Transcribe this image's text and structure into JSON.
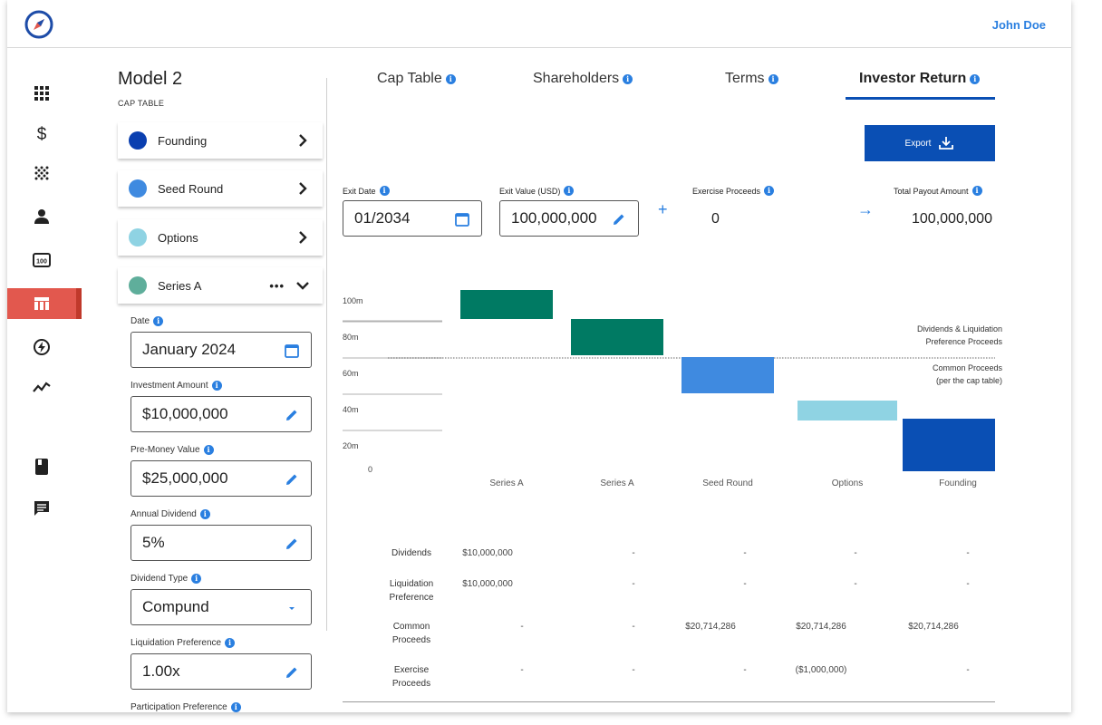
{
  "header": {
    "user_name": "John Doe"
  },
  "nav": {
    "items": [
      {
        "name": "apps-grid-icon"
      },
      {
        "name": "dollar-icon"
      },
      {
        "name": "dots-pattern-icon"
      },
      {
        "name": "person-icon"
      },
      {
        "name": "counter-icon"
      },
      {
        "name": "table-icon",
        "active": true
      },
      {
        "name": "lightning-icon"
      },
      {
        "name": "trend-icon"
      },
      {
        "name": "book-icon"
      },
      {
        "name": "chat-icon"
      }
    ]
  },
  "panel": {
    "title": "Model 2",
    "subtitle": "CAP TABLE",
    "rounds": [
      {
        "label": "Founding",
        "color": "#0a3fb0"
      },
      {
        "label": "Seed Round",
        "color": "#3f8ae0"
      },
      {
        "label": "Options",
        "color": "#8fd3e3"
      },
      {
        "label": "Series A",
        "color": "#5fae9b",
        "more": "•••"
      }
    ],
    "fields": {
      "date": {
        "label": "Date",
        "value": "January 2024"
      },
      "investment": {
        "label": "Investment Amount",
        "value": "$10,000,000"
      },
      "premoney": {
        "label": "Pre-Money Value",
        "value": "$25,000,000"
      },
      "dividend": {
        "label": "Annual Dividend",
        "value": "5%"
      },
      "dividend_type": {
        "label": "Dividend Type",
        "value": "Compund"
      },
      "liquidation": {
        "label": "Liquidation Preference",
        "value": "1.00x"
      },
      "participation": {
        "label": "Participation Preference"
      }
    }
  },
  "tabs": [
    {
      "label": "Cap Table"
    },
    {
      "label": "Shareholders"
    },
    {
      "label": "Terms"
    },
    {
      "label": "Investor Return",
      "active": true
    }
  ],
  "export": {
    "label": "Export"
  },
  "exit": {
    "exit_date_label": "Exit Date",
    "exit_date": "01/2034",
    "exit_value_label": "Exit Value (USD)",
    "exit_value": "100,000,000",
    "exercise_label": "Exercise Proceeds",
    "exercise_value": "0",
    "total_label": "Total Payout Amount",
    "total_value": "100,000,000",
    "plus": "+",
    "arrow": "→"
  },
  "chart_data": {
    "type": "bar",
    "subtype": "waterfall",
    "y_tick_labels": [
      "100m",
      "80m",
      "60m",
      "40m",
      "20m",
      "0"
    ],
    "ylim": [
      0,
      100
    ],
    "categories": [
      "Series A",
      "Series A",
      "Seed Round",
      "Options",
      "Founding"
    ],
    "bars": [
      {
        "start": 84,
        "end": 100,
        "color": "#007a63"
      },
      {
        "start": 64,
        "end": 84,
        "color": "#007a63"
      },
      {
        "start": 43,
        "end": 63,
        "color": "#3f8ae0"
      },
      {
        "start": 28,
        "end": 39,
        "color": "#8fd3e3"
      },
      {
        "start": 0,
        "end": 29,
        "color": "#0a4fb4"
      }
    ],
    "annotations": [
      "Dividends & Liquidation",
      "Preference Proceeds",
      "Common Proceeds",
      "(per the cap table)"
    ],
    "divider_y": 63
  },
  "table": {
    "rows": [
      {
        "label": [
          "Dividends"
        ],
        "cells": [
          "$10,000,000",
          "-",
          "-",
          "-",
          "-"
        ]
      },
      {
        "label": [
          "Liquidation",
          "Preference"
        ],
        "cells": [
          "$10,000,000",
          "-",
          "-",
          "-",
          "-"
        ]
      },
      {
        "label": [
          "Common",
          "Proceeds"
        ],
        "cells": [
          "-",
          "-",
          "$20,714,286",
          "$20,714,286",
          "$20,714,286"
        ]
      },
      {
        "label": [
          "Exercise",
          "Proceeds"
        ],
        "cells": [
          "-",
          "-",
          "-",
          "($1,000,000)",
          "-"
        ]
      }
    ]
  }
}
